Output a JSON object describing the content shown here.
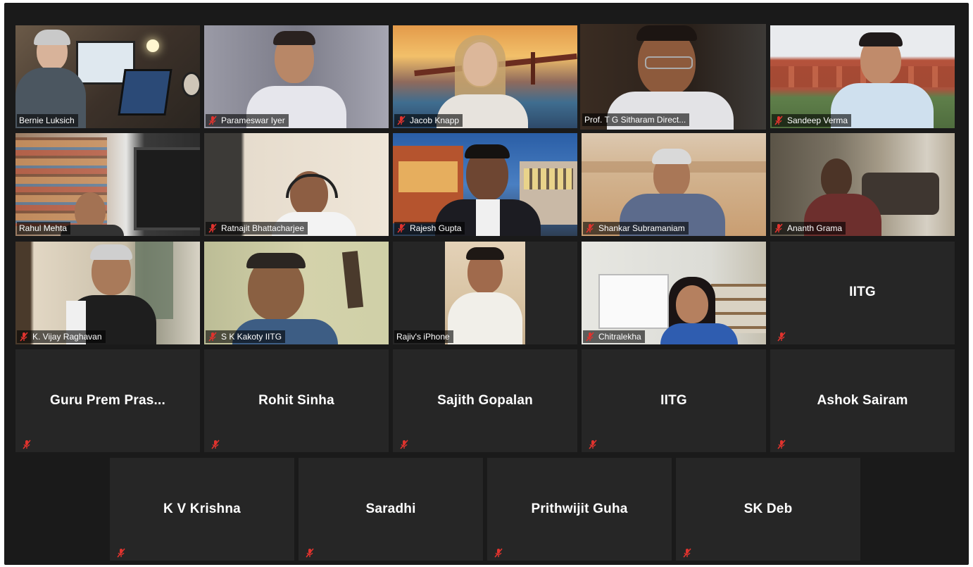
{
  "icons": {
    "mic": "mic-muted-icon"
  },
  "colors": {
    "background": "#1a1a1a",
    "tile": "#262626",
    "active_speaker": "#d7e84a",
    "mute_icon": "#e0332e"
  },
  "participants": [
    {
      "name": "Bernie Luksich",
      "video": true
    },
    {
      "name": "Parameswar Iyer",
      "video": true
    },
    {
      "name": "Jacob Knapp",
      "video": true
    },
    {
      "name": "Prof. T G Sitharam Direct...",
      "video": true,
      "active": true
    },
    {
      "name": "Sandeep Verma",
      "video": true
    },
    {
      "name": "Rahul Mehta",
      "video": true
    },
    {
      "name": "Ratnajit Bhattacharjee",
      "video": true
    },
    {
      "name": "Rajesh Gupta",
      "video": true
    },
    {
      "name": "Shankar Subramaniam",
      "video": true
    },
    {
      "name": "Ananth Grama",
      "video": true
    },
    {
      "name": "K. Vijay Raghavan",
      "video": true
    },
    {
      "name": "S K Kakoty IITG",
      "video": true
    },
    {
      "name": "Rajiv's iPhone",
      "video": true
    },
    {
      "name": "Chitralekha",
      "video": true
    },
    {
      "name": "IITG",
      "video": false
    },
    {
      "name": "Guru Prem Pras...",
      "video": false
    },
    {
      "name": "Rohit Sinha",
      "video": false
    },
    {
      "name": "Sajith Gopalan",
      "video": false
    },
    {
      "name": "IITG",
      "video": false
    },
    {
      "name": "Ashok Sairam",
      "video": false
    },
    {
      "name": "K V Krishna",
      "video": false
    },
    {
      "name": "Saradhi",
      "video": false
    },
    {
      "name": "Prithwijit Guha",
      "video": false
    },
    {
      "name": "SK Deb",
      "video": false
    }
  ]
}
